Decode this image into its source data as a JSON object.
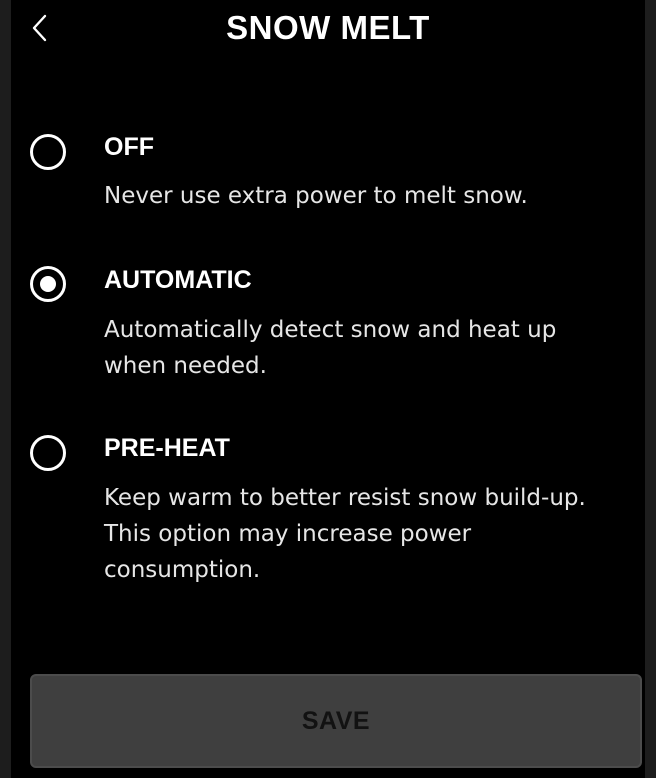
{
  "header": {
    "title": "SNOW MELT",
    "back_icon": "chevron-left-icon"
  },
  "options": [
    {
      "label": "OFF",
      "description": "Never use extra power to melt snow.",
      "selected": false
    },
    {
      "label": "AUTOMATIC",
      "description": "Automatically detect snow and heat up when needed.",
      "selected": true
    },
    {
      "label": "PRE-HEAT",
      "description": "Keep warm to better resist snow build-up. This option may increase power consumption.",
      "selected": false
    }
  ],
  "footer": {
    "save_label": "SAVE"
  },
  "colors": {
    "background": "#000000",
    "text": "#ffffff",
    "description_text": "#e6e6e6",
    "save_button_bg": "#3f3f3f",
    "save_button_text": "#121212"
  }
}
